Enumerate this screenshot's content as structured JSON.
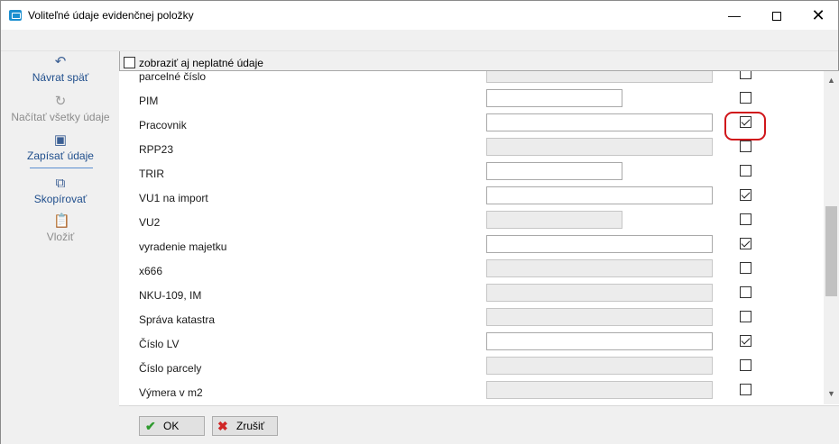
{
  "window": {
    "title": "Voliteľné údaje evidenčnej položky",
    "minimize": "—",
    "close": "✕"
  },
  "sidebar": {
    "items": [
      {
        "label": "Návrat späť",
        "icon": "undo-arrow-icon",
        "glyph": "↶",
        "state": "active"
      },
      {
        "label": "Načítať všetky údaje",
        "icon": "reload-icon",
        "glyph": "↻",
        "state": "disabled"
      },
      {
        "label": "Zapísať údaje",
        "icon": "save-disk-icon",
        "glyph": "▣",
        "state": "active"
      },
      {
        "label": "Skopírovať",
        "icon": "copy-icon",
        "glyph": "⧉",
        "state": "active"
      },
      {
        "label": "Vložiť",
        "icon": "paste-icon",
        "glyph": "📋",
        "state": "disabled"
      }
    ]
  },
  "options": {
    "show_invalid_label": "zobraziť aj neplatné údaje",
    "show_invalid_checked": false
  },
  "grid": {
    "rows": [
      {
        "name": "parcelné číslo",
        "field": "gray",
        "value": "",
        "checked": false
      },
      {
        "name": "PIM",
        "field": "picker",
        "value": "",
        "checked": false
      },
      {
        "name": "Pracovnik",
        "field": "white",
        "value": "",
        "checked": true
      },
      {
        "name": "RPP23",
        "field": "gray",
        "value": "",
        "checked": false
      },
      {
        "name": "TRIR",
        "field": "picker",
        "value": "",
        "checked": false
      },
      {
        "name": "VU1 na import",
        "field": "white",
        "value": "",
        "checked": true
      },
      {
        "name": "VU2",
        "field": "gray-short",
        "value": "",
        "checked": false
      },
      {
        "name": "vyradenie majetku",
        "field": "white",
        "value": "",
        "checked": true
      },
      {
        "name": "x666",
        "field": "gray",
        "value": "",
        "checked": false
      },
      {
        "name": "NKU-109, IM",
        "field": "gray",
        "value": "",
        "checked": false
      },
      {
        "name": "Správa katastra",
        "field": "gray",
        "value": "",
        "checked": false
      },
      {
        "name": "Číslo LV",
        "field": "white",
        "value": "",
        "checked": true
      },
      {
        "name": "Číslo parcely",
        "field": "gray",
        "value": "",
        "checked": false
      },
      {
        "name": "Výmera v m2",
        "field": "gray",
        "value": "",
        "checked": false
      }
    ],
    "picker_label": "..."
  },
  "buttons": {
    "ok_label": "OK",
    "cancel_label": "Zrušiť"
  },
  "colors": {
    "highlight": "#d0161b",
    "accent": "#1f4e8c"
  }
}
